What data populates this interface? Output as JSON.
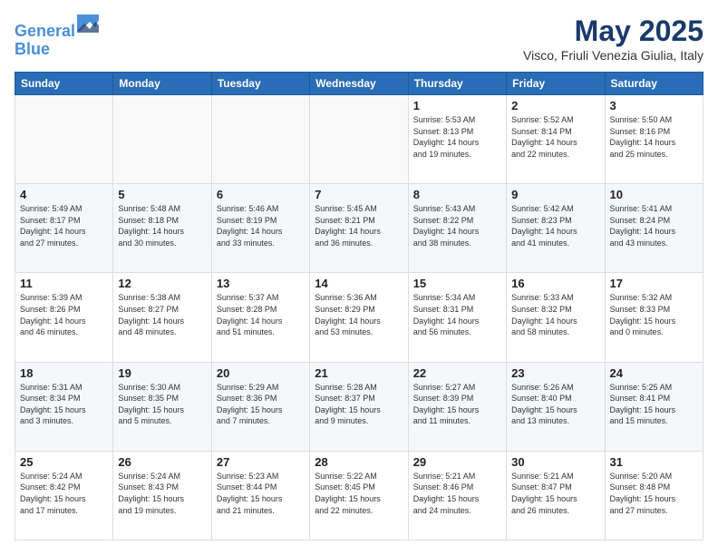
{
  "header": {
    "logo_line1": "General",
    "logo_line2": "Blue",
    "month": "May 2025",
    "location": "Visco, Friuli Venezia Giulia, Italy"
  },
  "days_of_week": [
    "Sunday",
    "Monday",
    "Tuesday",
    "Wednesday",
    "Thursday",
    "Friday",
    "Saturday"
  ],
  "weeks": [
    [
      {
        "num": "",
        "info": ""
      },
      {
        "num": "",
        "info": ""
      },
      {
        "num": "",
        "info": ""
      },
      {
        "num": "",
        "info": ""
      },
      {
        "num": "1",
        "info": "Sunrise: 5:53 AM\nSunset: 8:13 PM\nDaylight: 14 hours\nand 19 minutes."
      },
      {
        "num": "2",
        "info": "Sunrise: 5:52 AM\nSunset: 8:14 PM\nDaylight: 14 hours\nand 22 minutes."
      },
      {
        "num": "3",
        "info": "Sunrise: 5:50 AM\nSunset: 8:16 PM\nDaylight: 14 hours\nand 25 minutes."
      }
    ],
    [
      {
        "num": "4",
        "info": "Sunrise: 5:49 AM\nSunset: 8:17 PM\nDaylight: 14 hours\nand 27 minutes."
      },
      {
        "num": "5",
        "info": "Sunrise: 5:48 AM\nSunset: 8:18 PM\nDaylight: 14 hours\nand 30 minutes."
      },
      {
        "num": "6",
        "info": "Sunrise: 5:46 AM\nSunset: 8:19 PM\nDaylight: 14 hours\nand 33 minutes."
      },
      {
        "num": "7",
        "info": "Sunrise: 5:45 AM\nSunset: 8:21 PM\nDaylight: 14 hours\nand 36 minutes."
      },
      {
        "num": "8",
        "info": "Sunrise: 5:43 AM\nSunset: 8:22 PM\nDaylight: 14 hours\nand 38 minutes."
      },
      {
        "num": "9",
        "info": "Sunrise: 5:42 AM\nSunset: 8:23 PM\nDaylight: 14 hours\nand 41 minutes."
      },
      {
        "num": "10",
        "info": "Sunrise: 5:41 AM\nSunset: 8:24 PM\nDaylight: 14 hours\nand 43 minutes."
      }
    ],
    [
      {
        "num": "11",
        "info": "Sunrise: 5:39 AM\nSunset: 8:26 PM\nDaylight: 14 hours\nand 46 minutes."
      },
      {
        "num": "12",
        "info": "Sunrise: 5:38 AM\nSunset: 8:27 PM\nDaylight: 14 hours\nand 48 minutes."
      },
      {
        "num": "13",
        "info": "Sunrise: 5:37 AM\nSunset: 8:28 PM\nDaylight: 14 hours\nand 51 minutes."
      },
      {
        "num": "14",
        "info": "Sunrise: 5:36 AM\nSunset: 8:29 PM\nDaylight: 14 hours\nand 53 minutes."
      },
      {
        "num": "15",
        "info": "Sunrise: 5:34 AM\nSunset: 8:31 PM\nDaylight: 14 hours\nand 56 minutes."
      },
      {
        "num": "16",
        "info": "Sunrise: 5:33 AM\nSunset: 8:32 PM\nDaylight: 14 hours\nand 58 minutes."
      },
      {
        "num": "17",
        "info": "Sunrise: 5:32 AM\nSunset: 8:33 PM\nDaylight: 15 hours\nand 0 minutes."
      }
    ],
    [
      {
        "num": "18",
        "info": "Sunrise: 5:31 AM\nSunset: 8:34 PM\nDaylight: 15 hours\nand 3 minutes."
      },
      {
        "num": "19",
        "info": "Sunrise: 5:30 AM\nSunset: 8:35 PM\nDaylight: 15 hours\nand 5 minutes."
      },
      {
        "num": "20",
        "info": "Sunrise: 5:29 AM\nSunset: 8:36 PM\nDaylight: 15 hours\nand 7 minutes."
      },
      {
        "num": "21",
        "info": "Sunrise: 5:28 AM\nSunset: 8:37 PM\nDaylight: 15 hours\nand 9 minutes."
      },
      {
        "num": "22",
        "info": "Sunrise: 5:27 AM\nSunset: 8:39 PM\nDaylight: 15 hours\nand 11 minutes."
      },
      {
        "num": "23",
        "info": "Sunrise: 5:26 AM\nSunset: 8:40 PM\nDaylight: 15 hours\nand 13 minutes."
      },
      {
        "num": "24",
        "info": "Sunrise: 5:25 AM\nSunset: 8:41 PM\nDaylight: 15 hours\nand 15 minutes."
      }
    ],
    [
      {
        "num": "25",
        "info": "Sunrise: 5:24 AM\nSunset: 8:42 PM\nDaylight: 15 hours\nand 17 minutes."
      },
      {
        "num": "26",
        "info": "Sunrise: 5:24 AM\nSunset: 8:43 PM\nDaylight: 15 hours\nand 19 minutes."
      },
      {
        "num": "27",
        "info": "Sunrise: 5:23 AM\nSunset: 8:44 PM\nDaylight: 15 hours\nand 21 minutes."
      },
      {
        "num": "28",
        "info": "Sunrise: 5:22 AM\nSunset: 8:45 PM\nDaylight: 15 hours\nand 22 minutes."
      },
      {
        "num": "29",
        "info": "Sunrise: 5:21 AM\nSunset: 8:46 PM\nDaylight: 15 hours\nand 24 minutes."
      },
      {
        "num": "30",
        "info": "Sunrise: 5:21 AM\nSunset: 8:47 PM\nDaylight: 15 hours\nand 26 minutes."
      },
      {
        "num": "31",
        "info": "Sunrise: 5:20 AM\nSunset: 8:48 PM\nDaylight: 15 hours\nand 27 minutes."
      }
    ]
  ]
}
